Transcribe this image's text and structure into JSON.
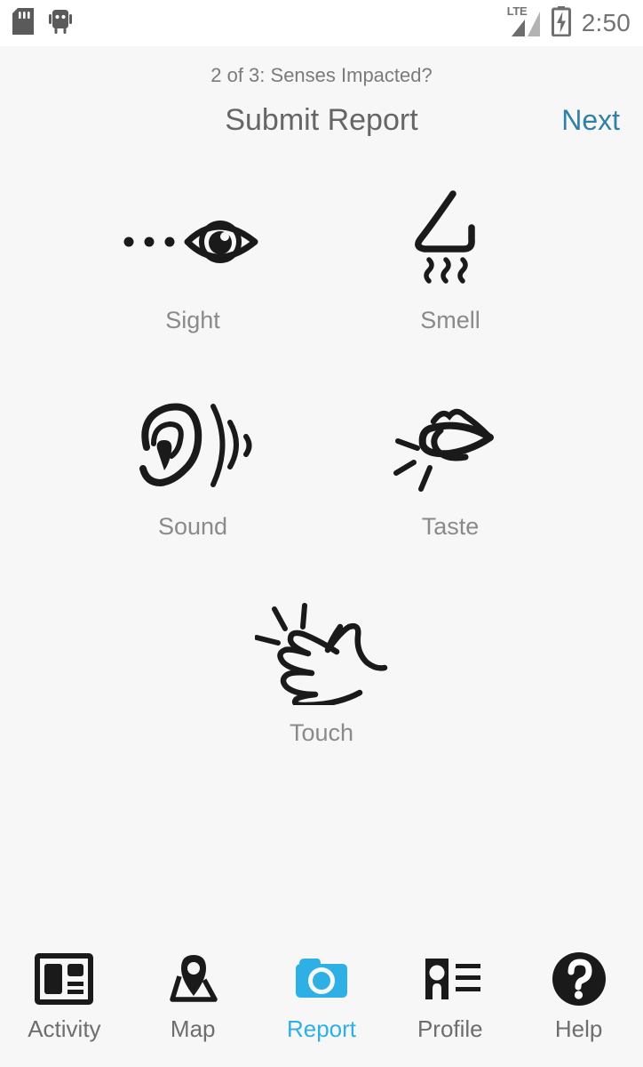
{
  "status_bar": {
    "icons": [
      "sd-card-icon",
      "android-robot-icon"
    ],
    "network": "LTE",
    "battery": "charging",
    "time": "2:50"
  },
  "header": {
    "step_label": "2 of 3: Senses Impacted?",
    "title": "Submit Report",
    "next_label": "Next"
  },
  "senses": [
    {
      "label": "Sight",
      "icon": "eye-icon"
    },
    {
      "label": "Smell",
      "icon": "nose-icon"
    },
    {
      "label": "Sound",
      "icon": "ear-icon"
    },
    {
      "label": "Taste",
      "icon": "tongue-icon"
    },
    {
      "label": "Touch",
      "icon": "hand-icon"
    }
  ],
  "tabs": [
    {
      "label": "Activity",
      "icon": "article-icon",
      "active": false
    },
    {
      "label": "Map",
      "icon": "map-pin-icon",
      "active": false
    },
    {
      "label": "Report",
      "icon": "camera-icon",
      "active": true
    },
    {
      "label": "Profile",
      "icon": "id-card-icon",
      "active": false
    },
    {
      "label": "Help",
      "icon": "question-mark-icon",
      "active": false
    }
  ],
  "colors": {
    "accent": "#2fb0e4",
    "link": "#3380a6",
    "background": "#f7f7f7",
    "status_bar_background": "#ffffff",
    "label_gray": "#8a8a8a",
    "icon_black": "#1a1a1a"
  }
}
